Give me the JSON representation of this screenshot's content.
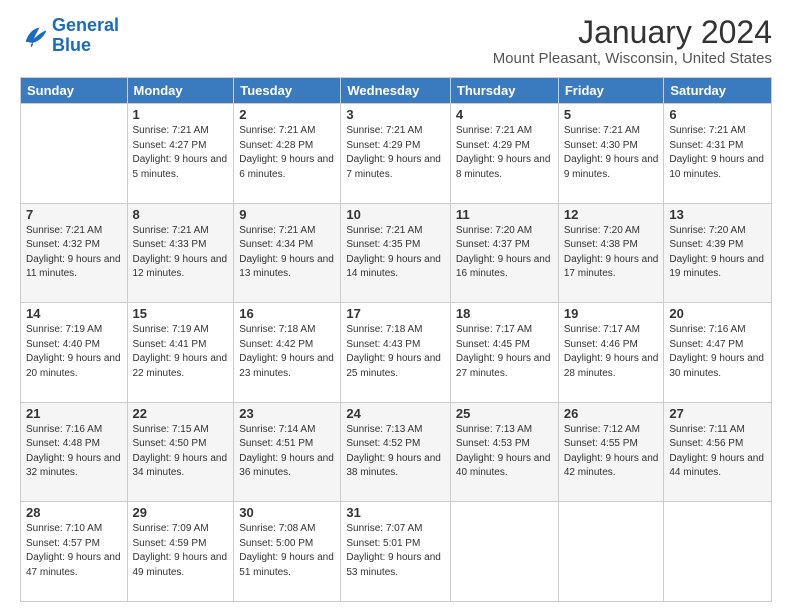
{
  "header": {
    "logo_line1": "General",
    "logo_line2": "Blue",
    "title": "January 2024",
    "subtitle": "Mount Pleasant, Wisconsin, United States"
  },
  "weekdays": [
    "Sunday",
    "Monday",
    "Tuesday",
    "Wednesday",
    "Thursday",
    "Friday",
    "Saturday"
  ],
  "weeks": [
    [
      {
        "day": "",
        "sunrise": "",
        "sunset": "",
        "daylight": ""
      },
      {
        "day": "1",
        "sunrise": "Sunrise: 7:21 AM",
        "sunset": "Sunset: 4:27 PM",
        "daylight": "Daylight: 9 hours and 5 minutes."
      },
      {
        "day": "2",
        "sunrise": "Sunrise: 7:21 AM",
        "sunset": "Sunset: 4:28 PM",
        "daylight": "Daylight: 9 hours and 6 minutes."
      },
      {
        "day": "3",
        "sunrise": "Sunrise: 7:21 AM",
        "sunset": "Sunset: 4:29 PM",
        "daylight": "Daylight: 9 hours and 7 minutes."
      },
      {
        "day": "4",
        "sunrise": "Sunrise: 7:21 AM",
        "sunset": "Sunset: 4:29 PM",
        "daylight": "Daylight: 9 hours and 8 minutes."
      },
      {
        "day": "5",
        "sunrise": "Sunrise: 7:21 AM",
        "sunset": "Sunset: 4:30 PM",
        "daylight": "Daylight: 9 hours and 9 minutes."
      },
      {
        "day": "6",
        "sunrise": "Sunrise: 7:21 AM",
        "sunset": "Sunset: 4:31 PM",
        "daylight": "Daylight: 9 hours and 10 minutes."
      }
    ],
    [
      {
        "day": "7",
        "sunrise": "Sunrise: 7:21 AM",
        "sunset": "Sunset: 4:32 PM",
        "daylight": "Daylight: 9 hours and 11 minutes."
      },
      {
        "day": "8",
        "sunrise": "Sunrise: 7:21 AM",
        "sunset": "Sunset: 4:33 PM",
        "daylight": "Daylight: 9 hours and 12 minutes."
      },
      {
        "day": "9",
        "sunrise": "Sunrise: 7:21 AM",
        "sunset": "Sunset: 4:34 PM",
        "daylight": "Daylight: 9 hours and 13 minutes."
      },
      {
        "day": "10",
        "sunrise": "Sunrise: 7:21 AM",
        "sunset": "Sunset: 4:35 PM",
        "daylight": "Daylight: 9 hours and 14 minutes."
      },
      {
        "day": "11",
        "sunrise": "Sunrise: 7:20 AM",
        "sunset": "Sunset: 4:37 PM",
        "daylight": "Daylight: 9 hours and 16 minutes."
      },
      {
        "day": "12",
        "sunrise": "Sunrise: 7:20 AM",
        "sunset": "Sunset: 4:38 PM",
        "daylight": "Daylight: 9 hours and 17 minutes."
      },
      {
        "day": "13",
        "sunrise": "Sunrise: 7:20 AM",
        "sunset": "Sunset: 4:39 PM",
        "daylight": "Daylight: 9 hours and 19 minutes."
      }
    ],
    [
      {
        "day": "14",
        "sunrise": "Sunrise: 7:19 AM",
        "sunset": "Sunset: 4:40 PM",
        "daylight": "Daylight: 9 hours and 20 minutes."
      },
      {
        "day": "15",
        "sunrise": "Sunrise: 7:19 AM",
        "sunset": "Sunset: 4:41 PM",
        "daylight": "Daylight: 9 hours and 22 minutes."
      },
      {
        "day": "16",
        "sunrise": "Sunrise: 7:18 AM",
        "sunset": "Sunset: 4:42 PM",
        "daylight": "Daylight: 9 hours and 23 minutes."
      },
      {
        "day": "17",
        "sunrise": "Sunrise: 7:18 AM",
        "sunset": "Sunset: 4:43 PM",
        "daylight": "Daylight: 9 hours and 25 minutes."
      },
      {
        "day": "18",
        "sunrise": "Sunrise: 7:17 AM",
        "sunset": "Sunset: 4:45 PM",
        "daylight": "Daylight: 9 hours and 27 minutes."
      },
      {
        "day": "19",
        "sunrise": "Sunrise: 7:17 AM",
        "sunset": "Sunset: 4:46 PM",
        "daylight": "Daylight: 9 hours and 28 minutes."
      },
      {
        "day": "20",
        "sunrise": "Sunrise: 7:16 AM",
        "sunset": "Sunset: 4:47 PM",
        "daylight": "Daylight: 9 hours and 30 minutes."
      }
    ],
    [
      {
        "day": "21",
        "sunrise": "Sunrise: 7:16 AM",
        "sunset": "Sunset: 4:48 PM",
        "daylight": "Daylight: 9 hours and 32 minutes."
      },
      {
        "day": "22",
        "sunrise": "Sunrise: 7:15 AM",
        "sunset": "Sunset: 4:50 PM",
        "daylight": "Daylight: 9 hours and 34 minutes."
      },
      {
        "day": "23",
        "sunrise": "Sunrise: 7:14 AM",
        "sunset": "Sunset: 4:51 PM",
        "daylight": "Daylight: 9 hours and 36 minutes."
      },
      {
        "day": "24",
        "sunrise": "Sunrise: 7:13 AM",
        "sunset": "Sunset: 4:52 PM",
        "daylight": "Daylight: 9 hours and 38 minutes."
      },
      {
        "day": "25",
        "sunrise": "Sunrise: 7:13 AM",
        "sunset": "Sunset: 4:53 PM",
        "daylight": "Daylight: 9 hours and 40 minutes."
      },
      {
        "day": "26",
        "sunrise": "Sunrise: 7:12 AM",
        "sunset": "Sunset: 4:55 PM",
        "daylight": "Daylight: 9 hours and 42 minutes."
      },
      {
        "day": "27",
        "sunrise": "Sunrise: 7:11 AM",
        "sunset": "Sunset: 4:56 PM",
        "daylight": "Daylight: 9 hours and 44 minutes."
      }
    ],
    [
      {
        "day": "28",
        "sunrise": "Sunrise: 7:10 AM",
        "sunset": "Sunset: 4:57 PM",
        "daylight": "Daylight: 9 hours and 47 minutes."
      },
      {
        "day": "29",
        "sunrise": "Sunrise: 7:09 AM",
        "sunset": "Sunset: 4:59 PM",
        "daylight": "Daylight: 9 hours and 49 minutes."
      },
      {
        "day": "30",
        "sunrise": "Sunrise: 7:08 AM",
        "sunset": "Sunset: 5:00 PM",
        "daylight": "Daylight: 9 hours and 51 minutes."
      },
      {
        "day": "31",
        "sunrise": "Sunrise: 7:07 AM",
        "sunset": "Sunset: 5:01 PM",
        "daylight": "Daylight: 9 hours and 53 minutes."
      },
      {
        "day": "",
        "sunrise": "",
        "sunset": "",
        "daylight": ""
      },
      {
        "day": "",
        "sunrise": "",
        "sunset": "",
        "daylight": ""
      },
      {
        "day": "",
        "sunrise": "",
        "sunset": "",
        "daylight": ""
      }
    ]
  ]
}
